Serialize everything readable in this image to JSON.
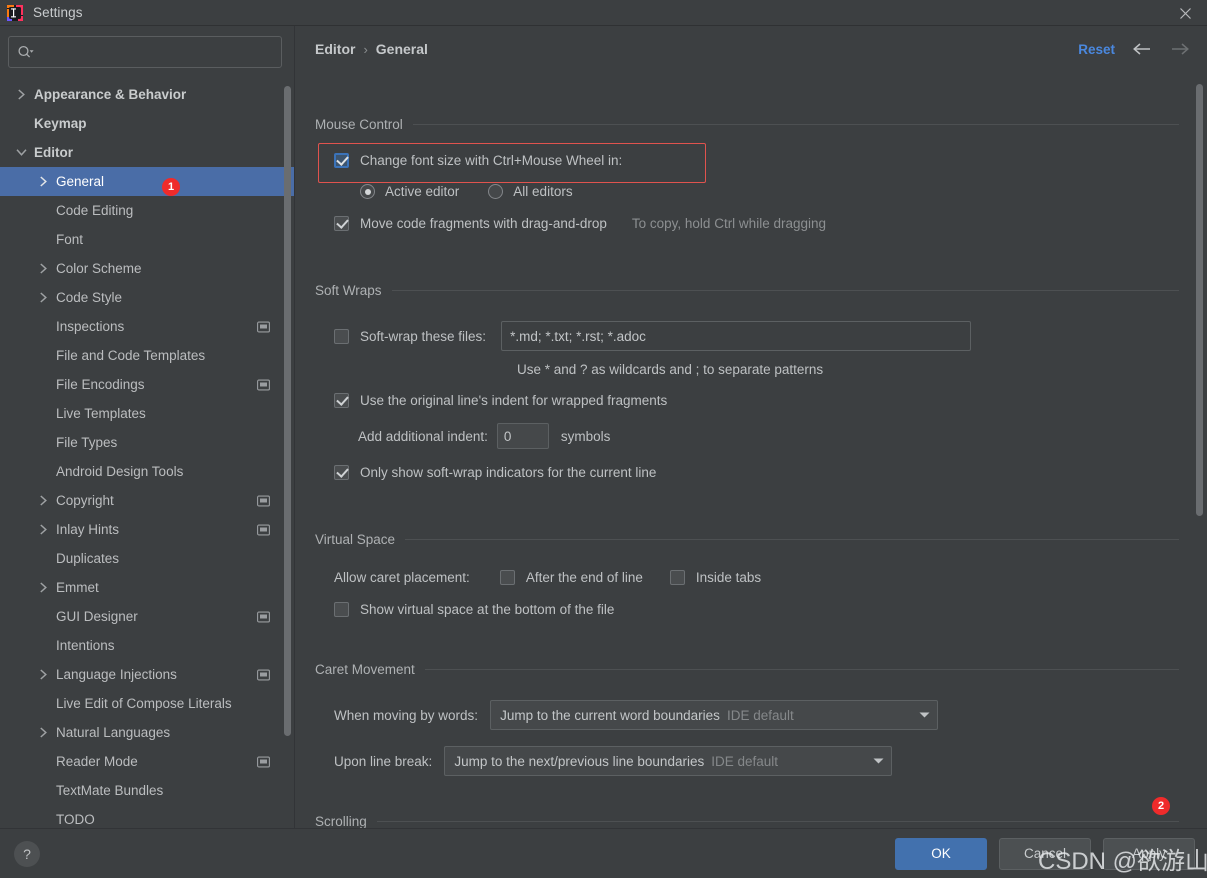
{
  "window": {
    "title": "Settings",
    "app_icon": "intellij-idea-logo",
    "close_icon": "close-icon"
  },
  "sidebar": {
    "search": {
      "placeholder": "",
      "value": "",
      "icon": "search-icon"
    },
    "items": [
      {
        "label": "Appearance & Behavior",
        "indent": 0,
        "arrow": "right",
        "bold": true,
        "config": false,
        "selected": false
      },
      {
        "label": "Keymap",
        "indent": 0,
        "arrow": "none",
        "bold": true,
        "config": false,
        "selected": false
      },
      {
        "label": "Editor",
        "indent": 0,
        "arrow": "down",
        "bold": true,
        "config": false,
        "selected": false
      },
      {
        "label": "General",
        "indent": 1,
        "arrow": "right",
        "bold": false,
        "config": false,
        "selected": true
      },
      {
        "label": "Code Editing",
        "indent": 1,
        "arrow": "none",
        "bold": false,
        "config": false,
        "selected": false
      },
      {
        "label": "Font",
        "indent": 1,
        "arrow": "none",
        "bold": false,
        "config": false,
        "selected": false
      },
      {
        "label": "Color Scheme",
        "indent": 1,
        "arrow": "right",
        "bold": false,
        "config": false,
        "selected": false
      },
      {
        "label": "Code Style",
        "indent": 1,
        "arrow": "right",
        "bold": false,
        "config": false,
        "selected": false
      },
      {
        "label": "Inspections",
        "indent": 1,
        "arrow": "none",
        "bold": false,
        "config": true,
        "selected": false
      },
      {
        "label": "File and Code Templates",
        "indent": 1,
        "arrow": "none",
        "bold": false,
        "config": false,
        "selected": false
      },
      {
        "label": "File Encodings",
        "indent": 1,
        "arrow": "none",
        "bold": false,
        "config": true,
        "selected": false
      },
      {
        "label": "Live Templates",
        "indent": 1,
        "arrow": "none",
        "bold": false,
        "config": false,
        "selected": false
      },
      {
        "label": "File Types",
        "indent": 1,
        "arrow": "none",
        "bold": false,
        "config": false,
        "selected": false
      },
      {
        "label": "Android Design Tools",
        "indent": 1,
        "arrow": "none",
        "bold": false,
        "config": false,
        "selected": false
      },
      {
        "label": "Copyright",
        "indent": 1,
        "arrow": "right",
        "bold": false,
        "config": true,
        "selected": false
      },
      {
        "label": "Inlay Hints",
        "indent": 1,
        "arrow": "right",
        "bold": false,
        "config": true,
        "selected": false
      },
      {
        "label": "Duplicates",
        "indent": 1,
        "arrow": "none",
        "bold": false,
        "config": false,
        "selected": false
      },
      {
        "label": "Emmet",
        "indent": 1,
        "arrow": "right",
        "bold": false,
        "config": false,
        "selected": false
      },
      {
        "label": "GUI Designer",
        "indent": 1,
        "arrow": "none",
        "bold": false,
        "config": true,
        "selected": false
      },
      {
        "label": "Intentions",
        "indent": 1,
        "arrow": "none",
        "bold": false,
        "config": false,
        "selected": false
      },
      {
        "label": "Language Injections",
        "indent": 1,
        "arrow": "right",
        "bold": false,
        "config": true,
        "selected": false
      },
      {
        "label": "Live Edit of Compose Literals",
        "indent": 1,
        "arrow": "none",
        "bold": false,
        "config": false,
        "selected": false
      },
      {
        "label": "Natural Languages",
        "indent": 1,
        "arrow": "right",
        "bold": false,
        "config": false,
        "selected": false
      },
      {
        "label": "Reader Mode",
        "indent": 1,
        "arrow": "none",
        "bold": false,
        "config": true,
        "selected": false
      },
      {
        "label": "TextMate Bundles",
        "indent": 1,
        "arrow": "none",
        "bold": false,
        "config": false,
        "selected": false
      },
      {
        "label": "TODO",
        "indent": 1,
        "arrow": "none",
        "bold": false,
        "config": false,
        "selected": false
      }
    ]
  },
  "breadcrumb": {
    "parent": "Editor",
    "separator": "›",
    "current": "General",
    "reset_label": "Reset",
    "back_icon": "arrow-left-icon",
    "forward_icon": "arrow-right-icon"
  },
  "groups": {
    "mouse_control": {
      "title": "Mouse Control",
      "change_font_size": {
        "label": "Change font size with Ctrl+Mouse Wheel in:",
        "checked": true,
        "focused": true
      },
      "scope_options": [
        {
          "label": "Active editor",
          "selected": true
        },
        {
          "label": "All editors",
          "selected": false
        }
      ],
      "drag_drop": {
        "label": "Move code fragments with drag-and-drop",
        "checked": true
      },
      "drag_drop_hint": "To copy, hold Ctrl while dragging"
    },
    "soft_wraps": {
      "title": "Soft Wraps",
      "soft_wrap_files": {
        "label": "Soft-wrap these files:",
        "checked": false
      },
      "soft_wrap_value": "*.md; *.txt; *.rst; *.adoc",
      "wildcard_hint": "Use * and ? as wildcards and ; to separate patterns",
      "original_indent": {
        "label": "Use the original line's indent for wrapped fragments",
        "checked": true
      },
      "additional_indent_label": "Add additional indent:",
      "additional_indent_value": "0",
      "additional_indent_unit": "symbols",
      "indicators_current_line": {
        "label": "Only show soft-wrap indicators for the current line",
        "checked": true
      }
    },
    "virtual_space": {
      "title": "Virtual Space",
      "caret_placement_label": "Allow caret placement:",
      "caret_options": [
        {
          "label": "After the end of line",
          "checked": false
        },
        {
          "label": "Inside tabs",
          "checked": false
        }
      ],
      "show_virtual_space": {
        "label": "Show virtual space at the bottom of the file",
        "checked": false
      }
    },
    "caret_movement": {
      "title": "Caret Movement",
      "rows": [
        {
          "label": "When moving by words:",
          "value": "Jump to the current word boundaries",
          "sub": "IDE default"
        },
        {
          "label": "Upon line break:",
          "value": "Jump to the next/previous line boundaries",
          "sub": "IDE default"
        }
      ]
    },
    "scrolling": {
      "title": "Scrolling"
    }
  },
  "annotations": [
    {
      "id": "1",
      "text": "1"
    },
    {
      "id": "2",
      "text": "2"
    }
  ],
  "footer": {
    "help_label": "?",
    "buttons": [
      {
        "label": "OK",
        "primary": true
      },
      {
        "label": "Cancel",
        "primary": false
      },
      {
        "label": "Apply",
        "primary": false
      }
    ]
  },
  "watermark": {
    "text": "CSDN @欲游山河"
  },
  "colors": {
    "accent_blue": "#4a88df",
    "selection_blue": "#4a6da7",
    "primary_button": "#4271ae",
    "badge_red": "#ef2b2b",
    "highlight_red": "#e0534e",
    "panel_bg": "#3c3f41"
  }
}
